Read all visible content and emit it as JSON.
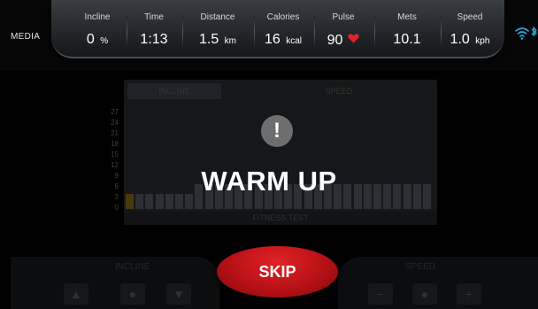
{
  "header": {
    "media_label": "MEDIA",
    "stats": [
      {
        "label": "Incline",
        "value": "0",
        "unit": "%"
      },
      {
        "label": "Time",
        "value": "1:13",
        "unit": ""
      },
      {
        "label": "Distance",
        "value": "1.5",
        "unit": "km"
      },
      {
        "label": "Calories",
        "value": "16",
        "unit": "kcal"
      },
      {
        "label": "Pulse",
        "value": "90",
        "unit": ""
      },
      {
        "label": "Mets",
        "value": "10.1",
        "unit": ""
      },
      {
        "label": "Speed",
        "value": "1.0",
        "unit": "kph"
      }
    ],
    "status_icons": [
      "wifi-icon",
      "bluetooth-icon"
    ],
    "colors": {
      "heart": "#e0242a"
    }
  },
  "chart": {
    "tabs": {
      "incline": "INCLINE",
      "speed": "SPEED"
    },
    "footer": "FITNESS TEST",
    "y_ticks": [
      "27",
      "24",
      "21",
      "18",
      "15",
      "12",
      "9",
      "6",
      "3",
      "0"
    ]
  },
  "chart_data": {
    "type": "bar",
    "title": "",
    "ylim": [
      0,
      27
    ],
    "values": [
      3,
      3,
      3,
      3,
      3,
      3,
      3,
      5,
      5,
      5,
      5,
      5,
      5,
      5,
      5,
      5,
      5,
      5,
      5,
      5,
      5,
      5,
      5,
      5,
      5,
      5,
      5,
      5,
      5,
      5,
      5
    ],
    "highlight_index": 0,
    "colors": {
      "highlight": "#4a3a0a",
      "bar": "#2c3035"
    }
  },
  "overlay": {
    "alert_icon": "exclamation-icon",
    "alert_symbol": "!",
    "title": "WARM UP",
    "skip_label": "SKIP",
    "skip_color": "#c8141a"
  },
  "controls": {
    "incline_label": "INCLINE",
    "speed_label": "SPEED",
    "incline_buttons": [
      "▲",
      "●",
      "▼"
    ],
    "speed_buttons": [
      "−",
      "●",
      "+"
    ]
  }
}
